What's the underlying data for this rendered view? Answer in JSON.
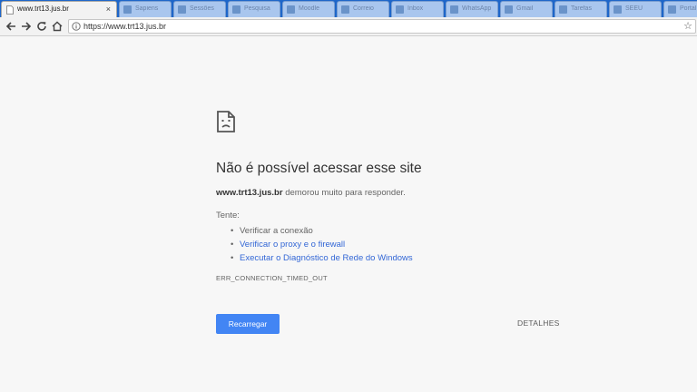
{
  "browser": {
    "active_tab": {
      "title": "www.trt13.jus.br",
      "close_symbol": "×"
    },
    "inactive_tabs": [
      {
        "title": "Sapiens"
      },
      {
        "title": "Sessões"
      },
      {
        "title": "Pesquisa"
      },
      {
        "title": "Moodle"
      },
      {
        "title": "Correio"
      },
      {
        "title": "Inbox"
      },
      {
        "title": "WhatsApp"
      },
      {
        "title": "Gmail"
      },
      {
        "title": "Tarefas"
      },
      {
        "title": "SEEU"
      },
      {
        "title": "Portal"
      }
    ],
    "toolbar": {
      "url": "https://www.trt13.jus.br",
      "star_symbol": "☆"
    }
  },
  "error_page": {
    "heading": "Não é possível acessar esse site",
    "host": "www.trt13.jus.br",
    "description_suffix": " demorou muito para responder.",
    "try_label": "Tente:",
    "suggestions": [
      "Verificar a conexão",
      "Verificar o proxy e o firewall",
      "Executar o Diagnóstico de Rede do Windows"
    ],
    "error_code": "ERR_CONNECTION_TIMED_OUT",
    "reload_label": "Recarregar",
    "details_label": "DETALHES"
  },
  "colors": {
    "tabstrip": "#1e66c9",
    "link": "#3367d6",
    "button": "#4285f4",
    "page_bg": "#f7f7f7"
  }
}
